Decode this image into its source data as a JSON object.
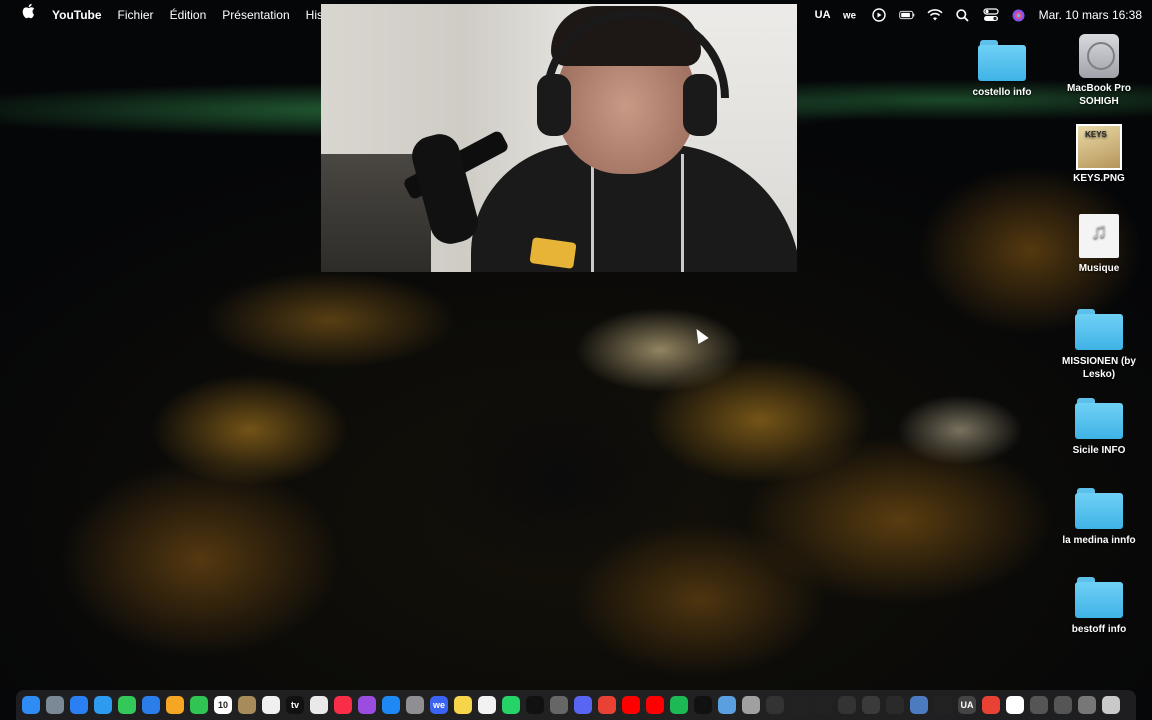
{
  "menubar": {
    "app_name": "YouTube",
    "menus": [
      "Fichier",
      "Édition",
      "Présentation",
      "Historique"
    ],
    "status": {
      "keyboard_layout": "UA",
      "datetime": "Mar. 10 mars  16:38"
    },
    "status_icons": [
      "wetransfer-icon",
      "play-circle-icon",
      "battery-icon",
      "wifi-icon",
      "search-icon",
      "control-center-icon",
      "siri-icon"
    ]
  },
  "desktop": {
    "icons": [
      {
        "label": "costello info",
        "type": "folder"
      },
      {
        "label": "MacBook Pro SOHIGH",
        "type": "drive"
      },
      {
        "label": "KEYS.PNG",
        "type": "image",
        "thumb_text": "KEYS"
      },
      {
        "label": "Musique",
        "type": "music"
      },
      {
        "label": "MISSIONEN (by Lesko)",
        "type": "folder"
      },
      {
        "label": "Sicile INFO",
        "type": "folder"
      },
      {
        "label": "la medina innfo",
        "type": "folder"
      },
      {
        "label": "bestoff info",
        "type": "folder"
      }
    ]
  },
  "dock": {
    "items": [
      {
        "name": "finder-icon",
        "color": "#2f8cf5"
      },
      {
        "name": "launchpad-icon",
        "color": "#7b8895"
      },
      {
        "name": "app-store-icon",
        "color": "#2a7ff2"
      },
      {
        "name": "safari-icon",
        "color": "#2d9cf0"
      },
      {
        "name": "messages-icon",
        "color": "#34c759"
      },
      {
        "name": "mail-icon",
        "color": "#2b7de9"
      },
      {
        "name": "photos-icon",
        "color": "#f5a623"
      },
      {
        "name": "facetime-icon",
        "color": "#30c552"
      },
      {
        "name": "calendar-icon",
        "color": "#ffffff",
        "text": "10"
      },
      {
        "name": "notes-icon",
        "color": "#a88b5a"
      },
      {
        "name": "reminders-icon",
        "color": "#f0f0f0"
      },
      {
        "name": "apple-tv-icon",
        "color": "#111111",
        "text": "tv"
      },
      {
        "name": "mail-alt-icon",
        "color": "#e9e9e9"
      },
      {
        "name": "music-icon",
        "color": "#fa2d48"
      },
      {
        "name": "podcasts-icon",
        "color": "#9b4de0"
      },
      {
        "name": "app-store-alt-icon",
        "color": "#1e88f5"
      },
      {
        "name": "system-settings-icon",
        "color": "#8e8e93"
      },
      {
        "name": "wetransfer-dock-icon",
        "color": "#3b64f5",
        "text": "we"
      },
      {
        "name": "notes-alt-icon",
        "color": "#f7d54a"
      },
      {
        "name": "textedit-icon",
        "color": "#f2f2f2"
      },
      {
        "name": "whatsapp-icon",
        "color": "#25d366"
      },
      {
        "name": "tiktok-icon",
        "color": "#111111"
      },
      {
        "name": "chatgpt-icon",
        "color": "#666666"
      },
      {
        "name": "discord-icon",
        "color": "#5865f2"
      },
      {
        "name": "chrome-icon",
        "color": "#e94235"
      },
      {
        "name": "youtube-icon",
        "color": "#ff0000"
      },
      {
        "name": "youtube-music-icon",
        "color": "#ff0000"
      },
      {
        "name": "spotify-icon",
        "color": "#1db954"
      },
      {
        "name": "capcut-icon",
        "color": "#111111"
      },
      {
        "name": "preview-icon",
        "color": "#5aa0e0"
      },
      {
        "name": "disk-utility-icon",
        "color": "#a0a0a0"
      },
      {
        "name": "activity-monitor-icon",
        "color": "#333333"
      },
      {
        "name": "shazam-icon",
        "color": "#222222"
      },
      {
        "name": "wavve-icon",
        "color": "#222222"
      },
      {
        "name": "final-cut-icon",
        "color": "#333333"
      },
      {
        "name": "logic-icon",
        "color": "#3a3a3a"
      },
      {
        "name": "game-icon",
        "color": "#2a2a2a"
      },
      {
        "name": "quicktime-icon",
        "color": "#4c7bbf"
      },
      {
        "name": "terminal-icon",
        "color": "#222222"
      },
      {
        "name": "ukraine-vpn-icon",
        "color": "#444444",
        "text": "UA"
      },
      {
        "name": "chrome-alt-icon",
        "color": "#e94235"
      },
      {
        "name": "document-icon",
        "color": "#ffffff"
      },
      {
        "name": "window-thumb-icon",
        "color": "#555555"
      },
      {
        "name": "window-thumb-2-icon",
        "color": "#555555"
      },
      {
        "name": "window-thumb-3-icon",
        "color": "#777777"
      },
      {
        "name": "trash-icon",
        "color": "#c9c9c9"
      }
    ]
  }
}
